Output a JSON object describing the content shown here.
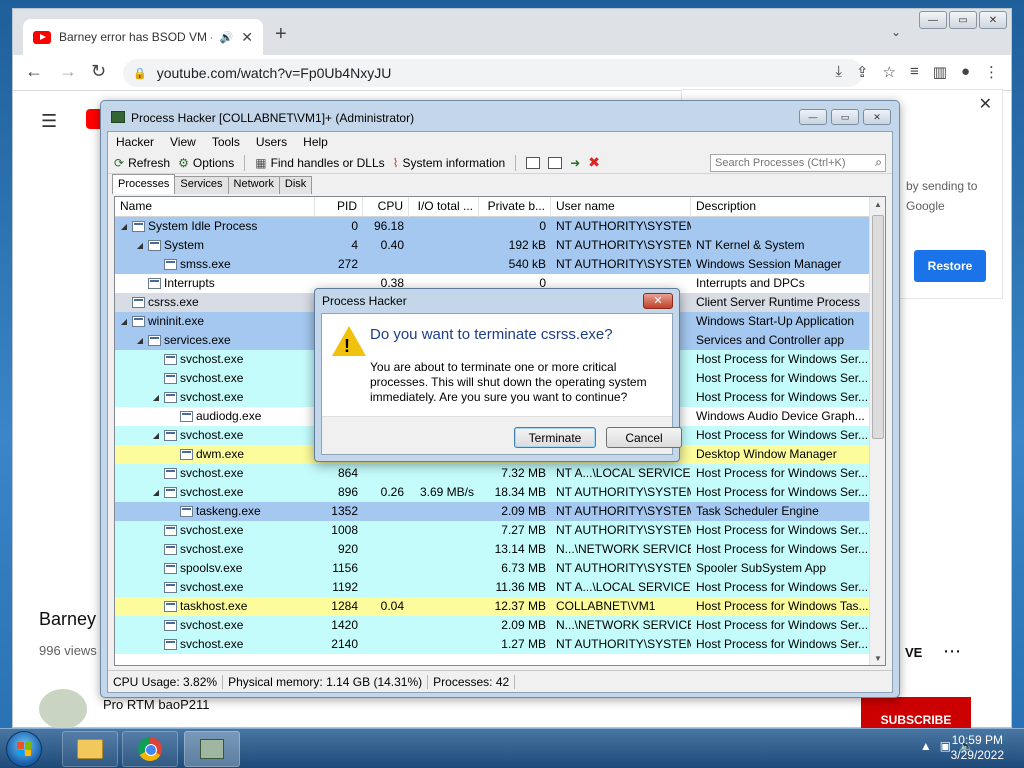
{
  "chrome": {
    "tab_title": "Barney error has BSOD VM -",
    "tab_audio_icon": "speaker-icon",
    "new_tab": "+",
    "url": "youtube.com/watch?v=Fp0Ub4NxyJU",
    "win_min": "—",
    "win_max": "▭",
    "win_close": "✕"
  },
  "youtube": {
    "panel_text": "by sending to Google",
    "restore": "Restore",
    "video_title": "Barney e",
    "views": "996 views",
    "save": "VE",
    "channel": "Pro RTM baoP211",
    "subscribe": "SUBSCRIBE"
  },
  "process_hacker": {
    "title": "Process Hacker [COLLABNET\\VM1]+ (Administrator)",
    "menu": [
      "Hacker",
      "View",
      "Tools",
      "Users",
      "Help"
    ],
    "toolbar": {
      "refresh": "Refresh",
      "options": "Options",
      "find": "Find handles or DLLs",
      "sysinfo": "System information",
      "search_placeholder": "Search Processes (Ctrl+K)"
    },
    "tabs": [
      "Processes",
      "Services",
      "Network",
      "Disk"
    ],
    "columns": [
      "Name",
      "PID",
      "CPU",
      "I/O total ...",
      "Private b...",
      "User name",
      "Description"
    ],
    "rows": [
      {
        "name": "System Idle Process",
        "pid": "0",
        "cpu": "96.18",
        "io": "",
        "priv": "0",
        "user": "NT AUTHORITY\\SYSTEM",
        "desc": "",
        "indent": 0,
        "arrow": true,
        "color": "#a4c8f0"
      },
      {
        "name": "System",
        "pid": "4",
        "cpu": "0.40",
        "io": "",
        "priv": "192 kB",
        "user": "NT AUTHORITY\\SYSTEM",
        "desc": "NT Kernel & System",
        "indent": 1,
        "arrow": true,
        "color": "#a4c8f0"
      },
      {
        "name": "smss.exe",
        "pid": "272",
        "cpu": "",
        "io": "",
        "priv": "540 kB",
        "user": "NT AUTHORITY\\SYSTEM",
        "desc": "Windows Session Manager",
        "indent": 2,
        "arrow": false,
        "color": "#a4c8f0"
      },
      {
        "name": "Interrupts",
        "pid": "",
        "cpu": "0.38",
        "io": "",
        "priv": "0",
        "user": "",
        "desc": "Interrupts and DPCs",
        "indent": 1,
        "arrow": false,
        "color": "#ffffff"
      },
      {
        "name": "csrss.exe",
        "pid": "",
        "cpu": "",
        "io": "",
        "priv": "",
        "user": "",
        "desc": "Client Server Runtime Process",
        "indent": 0,
        "arrow": false,
        "color": "#d8dce4"
      },
      {
        "name": "wininit.exe",
        "pid": "",
        "cpu": "",
        "io": "",
        "priv": "",
        "user": "",
        "desc": "Windows Start-Up Application",
        "indent": 0,
        "arrow": true,
        "color": "#a4c8f0"
      },
      {
        "name": "services.exe",
        "pid": "",
        "cpu": "",
        "io": "",
        "priv": "",
        "user": "",
        "desc": "Services and Controller app",
        "indent": 1,
        "arrow": true,
        "color": "#a4c8f0"
      },
      {
        "name": "svchost.exe",
        "pid": "",
        "cpu": "",
        "io": "",
        "priv": "",
        "user": "",
        "desc": "Host Process for Windows Ser...",
        "indent": 2,
        "arrow": false,
        "color": "#c4fcfc"
      },
      {
        "name": "svchost.exe",
        "pid": "",
        "cpu": "",
        "io": "",
        "priv": "",
        "user": "",
        "desc": "Host Process for Windows Ser...",
        "indent": 2,
        "arrow": false,
        "color": "#c4fcfc"
      },
      {
        "name": "svchost.exe",
        "pid": "",
        "cpu": "",
        "io": "",
        "priv": "",
        "user": "",
        "desc": "Host Process for Windows Ser...",
        "indent": 2,
        "arrow": true,
        "color": "#c4fcfc"
      },
      {
        "name": "audiodg.exe",
        "pid": "",
        "cpu": "",
        "io": "",
        "priv": "",
        "user": "",
        "desc": "Windows Audio Device Graph...",
        "indent": 3,
        "arrow": false,
        "color": "#ffffff"
      },
      {
        "name": "svchost.exe",
        "pid": "",
        "cpu": "",
        "io": "",
        "priv": "",
        "user": "",
        "desc": "Host Process for Windows Ser...",
        "indent": 2,
        "arrow": true,
        "color": "#c4fcfc"
      },
      {
        "name": "dwm.exe",
        "pid": "",
        "cpu": "",
        "io": "",
        "priv": "",
        "user": "",
        "desc": "Desktop Window Manager",
        "indent": 3,
        "arrow": false,
        "color": "#fcfc9c"
      },
      {
        "name": "svchost.exe",
        "pid": "864",
        "cpu": "",
        "io": "",
        "priv": "7.32 MB",
        "user": "NT A...\\LOCAL SERVICE",
        "desc": "Host Process for Windows Ser...",
        "indent": 2,
        "arrow": false,
        "color": "#c4fcfc"
      },
      {
        "name": "svchost.exe",
        "pid": "896",
        "cpu": "0.26",
        "io": "3.69 MB/s",
        "priv": "18.34 MB",
        "user": "NT AUTHORITY\\SYSTEM",
        "desc": "Host Process for Windows Ser...",
        "indent": 2,
        "arrow": true,
        "color": "#c4fcfc"
      },
      {
        "name": "taskeng.exe",
        "pid": "1352",
        "cpu": "",
        "io": "",
        "priv": "2.09 MB",
        "user": "NT AUTHORITY\\SYSTEM",
        "desc": "Task Scheduler Engine",
        "indent": 3,
        "arrow": false,
        "color": "#a4c8f0"
      },
      {
        "name": "svchost.exe",
        "pid": "1008",
        "cpu": "",
        "io": "",
        "priv": "7.27 MB",
        "user": "NT AUTHORITY\\SYSTEM",
        "desc": "Host Process for Windows Ser...",
        "indent": 2,
        "arrow": false,
        "color": "#c4fcfc"
      },
      {
        "name": "svchost.exe",
        "pid": "920",
        "cpu": "",
        "io": "",
        "priv": "13.14 MB",
        "user": "N...\\NETWORK SERVICE",
        "desc": "Host Process for Windows Ser...",
        "indent": 2,
        "arrow": false,
        "color": "#c4fcfc"
      },
      {
        "name": "spoolsv.exe",
        "pid": "1156",
        "cpu": "",
        "io": "",
        "priv": "6.73 MB",
        "user": "NT AUTHORITY\\SYSTEM",
        "desc": "Spooler SubSystem App",
        "indent": 2,
        "arrow": false,
        "color": "#c4fcfc"
      },
      {
        "name": "svchost.exe",
        "pid": "1192",
        "cpu": "",
        "io": "",
        "priv": "11.36 MB",
        "user": "NT A...\\LOCAL SERVICE",
        "desc": "Host Process for Windows Ser...",
        "indent": 2,
        "arrow": false,
        "color": "#c4fcfc"
      },
      {
        "name": "taskhost.exe",
        "pid": "1284",
        "cpu": "0.04",
        "io": "",
        "priv": "12.37 MB",
        "user": "COLLABNET\\VM1",
        "desc": "Host Process for Windows Tas...",
        "indent": 2,
        "arrow": false,
        "color": "#fcfc9c"
      },
      {
        "name": "svchost.exe",
        "pid": "1420",
        "cpu": "",
        "io": "",
        "priv": "2.09 MB",
        "user": "N...\\NETWORK SERVICE",
        "desc": "Host Process for Windows Ser...",
        "indent": 2,
        "arrow": false,
        "color": "#c4fcfc"
      },
      {
        "name": "svchost.exe",
        "pid": "2140",
        "cpu": "",
        "io": "",
        "priv": "1.27 MB",
        "user": "NT AUTHORITY\\SYSTEM",
        "desc": "Host Process for Windows Ser...",
        "indent": 2,
        "arrow": false,
        "color": "#c4fcfc"
      }
    ],
    "status": {
      "cpu": "CPU Usage: 3.82%",
      "memory": "Physical memory: 1.14 GB (14.31%)",
      "processes": "Processes: 42"
    }
  },
  "dialog": {
    "title": "Process Hacker",
    "close": "✕",
    "heading": "Do you want to terminate csrss.exe?",
    "message": "You are about to terminate one or more critical processes. This will shut down the operating system immediately. Are you sure you want to continue?",
    "terminate": "Terminate",
    "cancel": "Cancel"
  },
  "taskbar": {
    "time": "10:59 PM",
    "date": "3/29/2022"
  }
}
